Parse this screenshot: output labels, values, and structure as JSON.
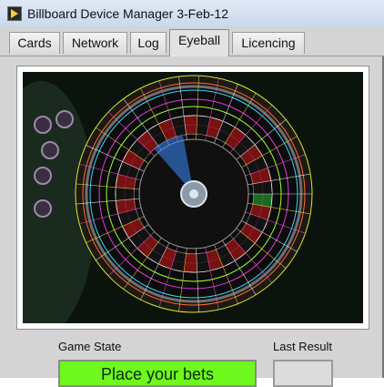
{
  "window": {
    "title": "Billboard Device Manager 3-Feb-12",
    "icon": "app-play-icon"
  },
  "tabs": [
    {
      "label": "Cards",
      "active": false
    },
    {
      "label": "Network",
      "active": false
    },
    {
      "label": "Log",
      "active": false
    },
    {
      "label": "Eyeball",
      "active": true
    },
    {
      "label": "Licencing",
      "active": false
    }
  ],
  "eyeball": {
    "game_state_label": "Game State",
    "game_state_value": "Place your bets",
    "last_result_label": "Last Result",
    "last_result_value": ""
  },
  "colors": {
    "game_state_bg": "#6ef81d",
    "title_bar": "#dfe9f5"
  }
}
